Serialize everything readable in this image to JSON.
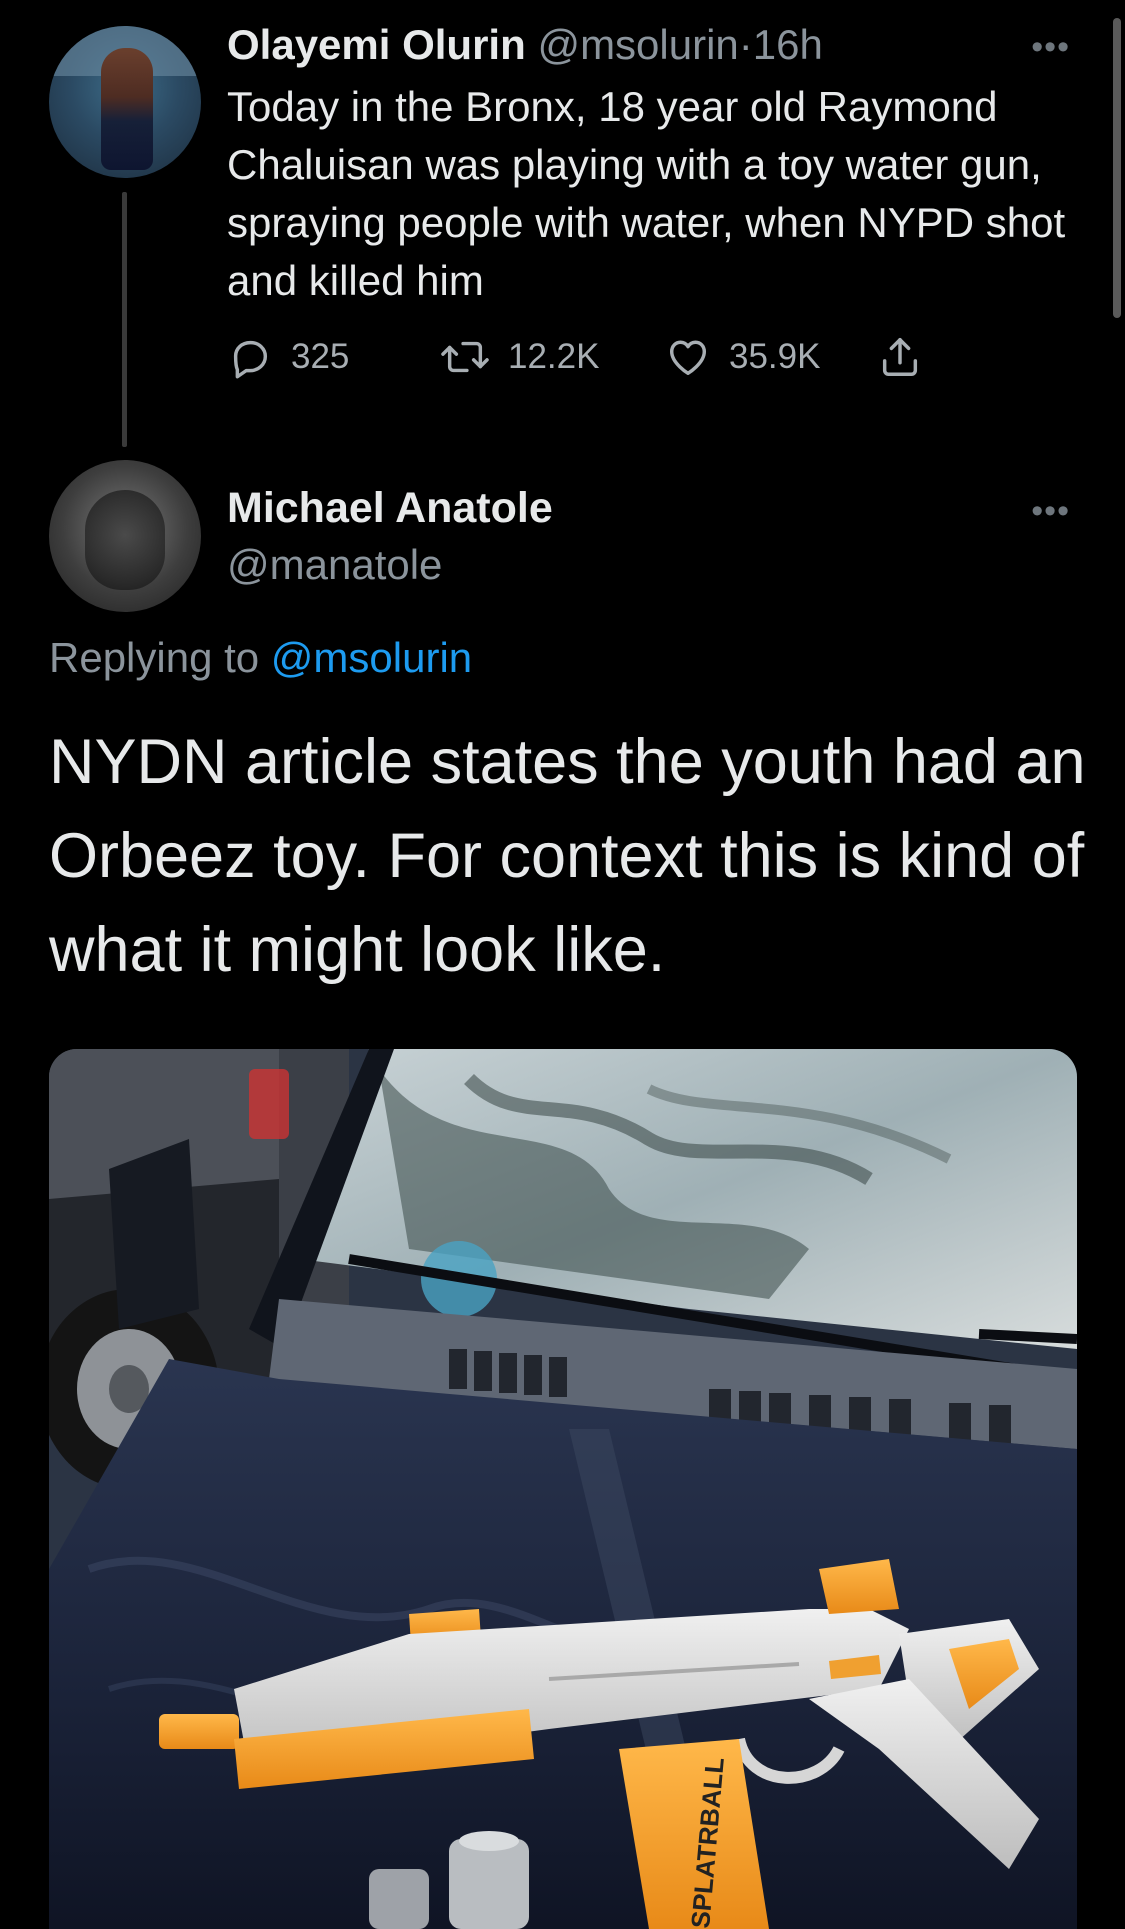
{
  "parent_tweet": {
    "author_name": "Olayemi Olurin",
    "author_handle": "@msolurin",
    "separator": "·",
    "time": "16h",
    "more_icon": "•••",
    "text": "Today in the Bronx, 18 year old Raymond Chaluisan was playing with a toy water gun, spraying people with water, when NYPD shot and killed him",
    "replies": "325",
    "retweets": "12.2K",
    "likes": "35.9K"
  },
  "reply_tweet": {
    "author_name": "Michael Anatole",
    "author_handle": "@manatole",
    "more_icon": "•••",
    "replying_prefix": "Replying to ",
    "replying_to": "@msolurin",
    "text": "NYDN article states the youth had an Orbeez toy. For context this is kind of  what it might look like.",
    "media_brand_text": "SPLATRBALL"
  },
  "colors": {
    "background": "#000000",
    "text": "#e7e9ea",
    "secondary": "#8b949c",
    "link": "#1d9bf0"
  }
}
